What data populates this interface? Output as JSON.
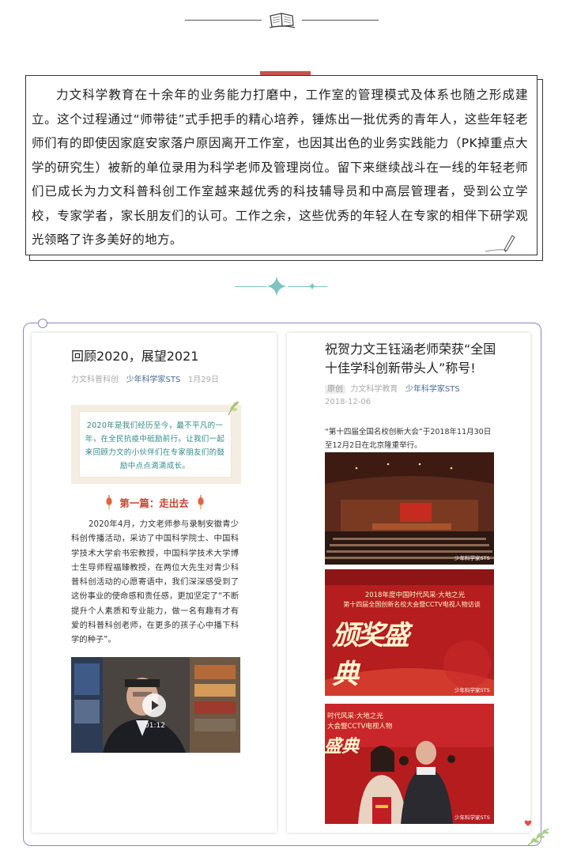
{
  "intro": {
    "paragraph": "力文科学教育在十余年的业务能力打磨中，工作室的管理模式及体系也随之形成建立。这个过程通过“师带徒”式手把手的精心培养，锤炼出一批优秀的青年人，这些年轻老师们有的即使因家庭安家落户原因离开工作室，也因其出色的业务实践能力（PK掉重点大学的研究生）被新的单位录用为科学老师及管理岗位。留下来继续战斗在一线的年轻老师们已成长为力文科普科创工作室越来越优秀的科技辅导员和中高层管理者，受到公立学校，专家学者，家长朋友们的认可。工作之余，这些优秀的年轻人在专家的相伴下研学观光领略了许多美好的地方。"
  },
  "left_post": {
    "title": "回顾2020，展望2021",
    "source": "力文科普科创",
    "author": "少年科学家STS",
    "date": "1月29日",
    "quote": "2020年是我们经历至今，最不平凡的一年，在全民抗疫中砥励前行。让我们一起来回顾力文的小伙伴们在专家朋友们的鼓励中点点滴滴成长。",
    "chapter": "第一篇：走出去",
    "body": "2020年4月，力文老师参与录制安徽青少科创传播活动，采访了中国科学院士、中国科学技术大学俞书宏教授，中国科学技术大学博士生导师程福臻教授，在两位大先生对青少科普科创活动的心愿寄语中，我们深深感受到了这份事业的使命感和责任感，更加坚定了“不断提升个人素质和专业能力，做一名有趣有才有爱的科普科创老师，在更多的孩子心中播下科学的种子”。",
    "video_time": "01:12"
  },
  "right_post": {
    "title": "祝贺力文王钰涵老师荣获“全国十佳学科创新带头人”称号!",
    "tag": "原创",
    "source": "力文科学教育",
    "author": "少年科学家STS",
    "date": "2018-12-06",
    "intro": "“第十四届全国名校创新大会”于2018年11月30日至12月2日在北京隆重举行。",
    "banner_line1": "2018年度中国时代风采·大地之光",
    "banner_line2": "第十四届全国创新名校大会暨CCTV电视人物访谈",
    "banner_big": "颁奖盛典",
    "photo3_line1": "时代风采·大地之光",
    "photo3_line2": "大会暨CCTV电视人物",
    "photo3_big": "盛典",
    "watermark": "少年科学家STS"
  },
  "colors": {
    "accent_red": "#c9514a",
    "frame_purple": "#8b84c7",
    "quote_teal": "#2f8a88",
    "chapter_red": "#c64731",
    "meta_blue": "#4a6b94"
  },
  "icons": [
    "book-icon",
    "pencil-icon",
    "sparkle-icon",
    "leaf-icon",
    "lantern-icon",
    "play-icon",
    "heart-icon",
    "fern-icon"
  ]
}
